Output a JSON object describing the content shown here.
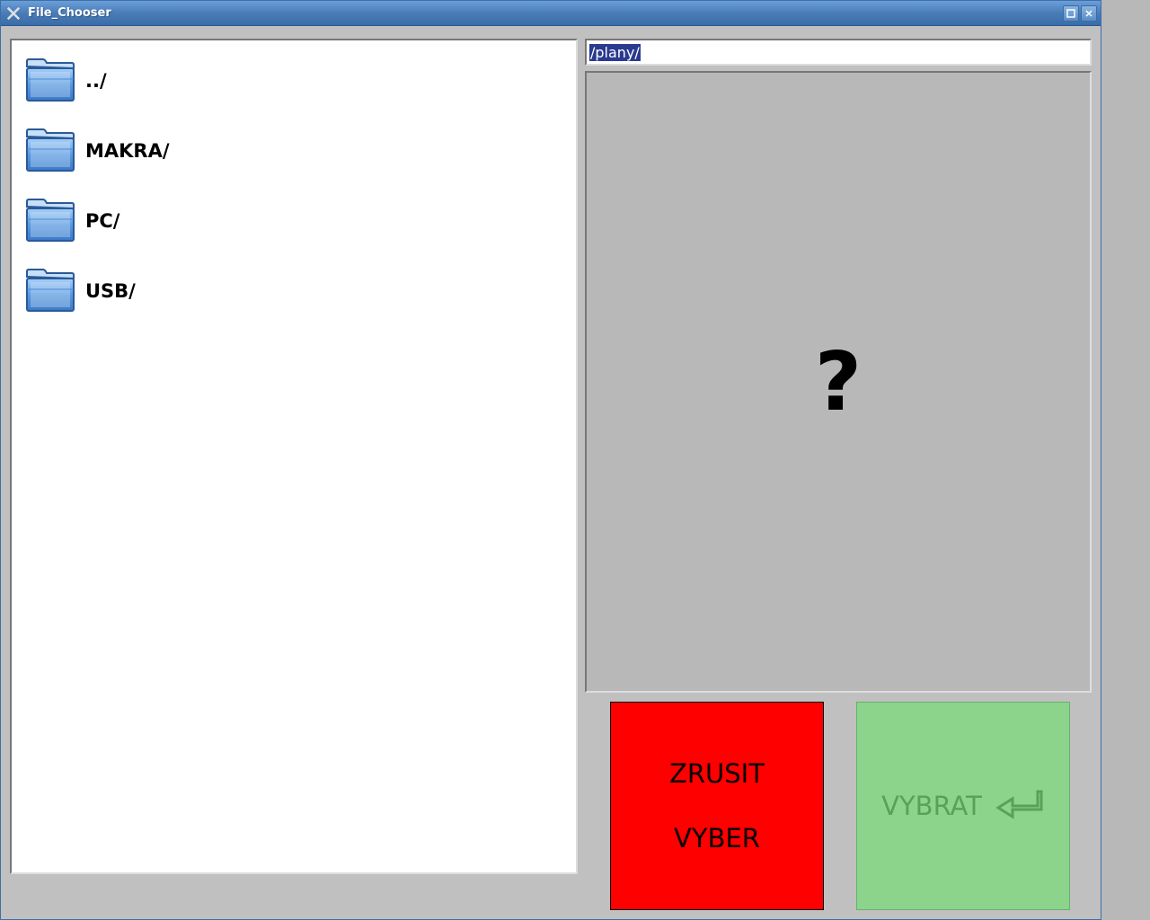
{
  "window": {
    "title": "File_Chooser"
  },
  "path": {
    "value": "/plany/"
  },
  "preview": {
    "placeholder": "?"
  },
  "files": [
    {
      "label": "../"
    },
    {
      "label": "MAKRA/"
    },
    {
      "label": "PC/"
    },
    {
      "label": "USB/"
    }
  ],
  "buttons": {
    "cancel_line1": "ZRUSIT",
    "cancel_line2": "VYBER",
    "select_label": "VYBRAT"
  }
}
